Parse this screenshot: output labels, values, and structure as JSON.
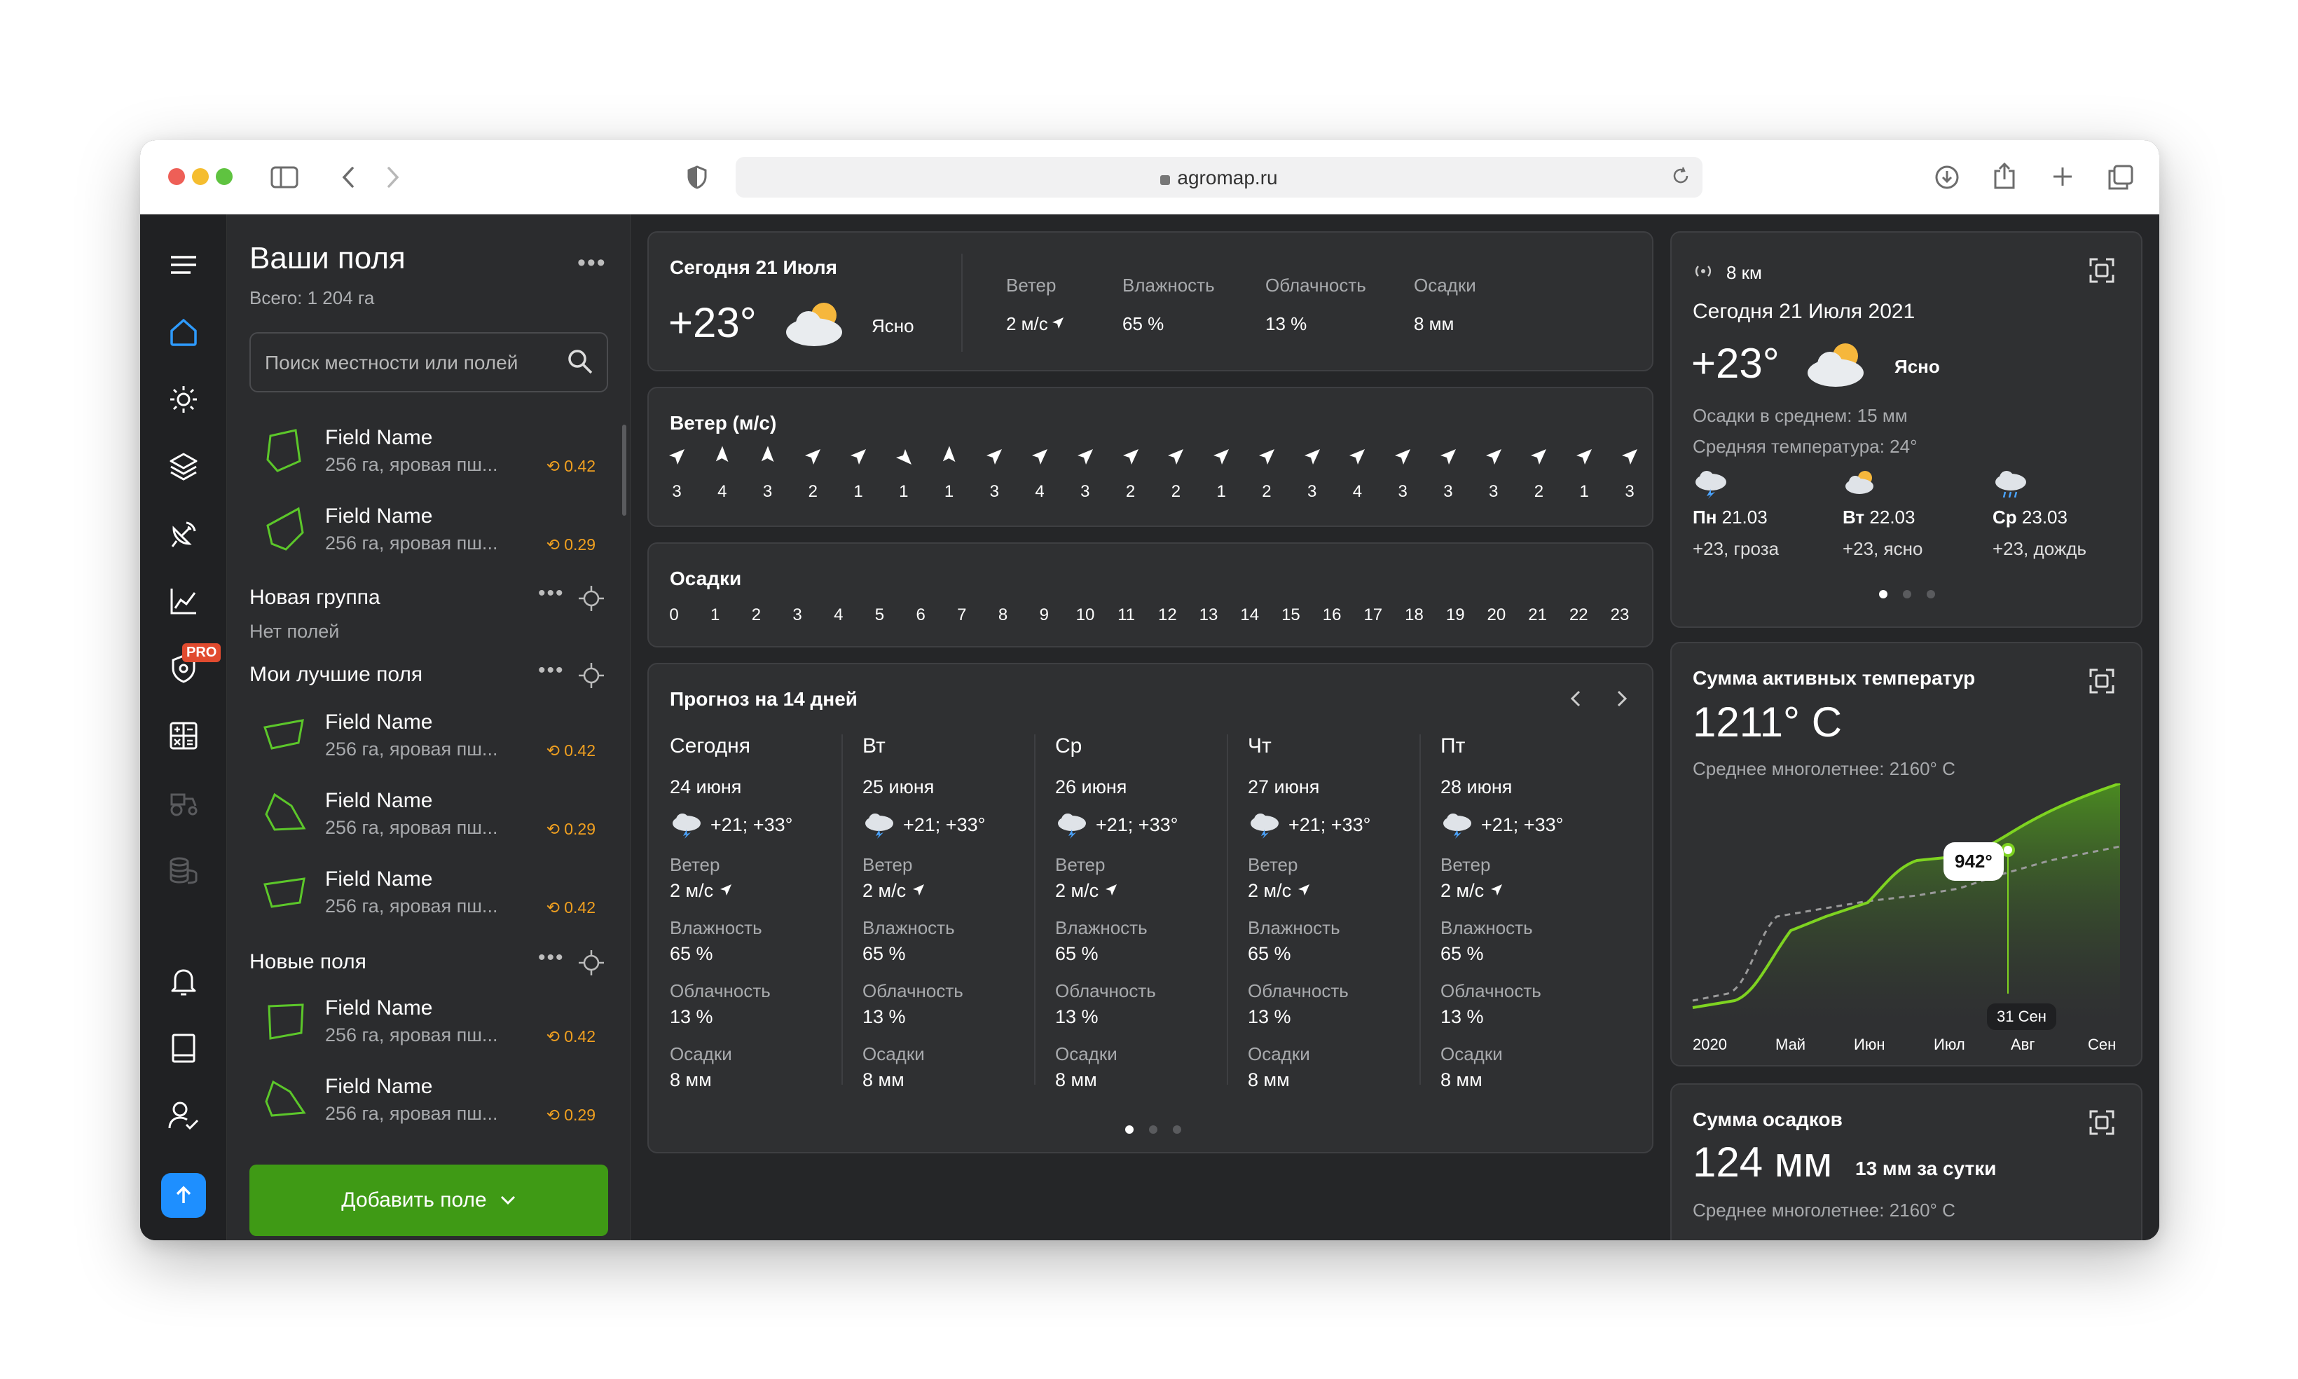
{
  "browser": {
    "url": "agromap.ru"
  },
  "rail": {
    "pro_badge": "PRO",
    "icons": [
      "menu-icon",
      "home-icon",
      "sun-icon",
      "layers-icon",
      "satellite-icon",
      "chart-icon",
      "shield-pro-icon",
      "calculator-icon",
      "tractor-icon",
      "coins-icon",
      "bell-icon",
      "book-icon",
      "user-check-icon",
      "upload-icon"
    ]
  },
  "panel": {
    "title": "Ваши поля",
    "total": "Всего: 1 204 га",
    "search_placeholder": "Поиск местности или полей",
    "add_button": "Добавить поле",
    "ungrouped": [
      {
        "name": "Field Name",
        "desc": "256 га, яровая пш...",
        "ndvi": "0.42"
      },
      {
        "name": "Field Name",
        "desc": "256 га, яровая пш...",
        "ndvi": "0.29"
      }
    ],
    "group1": {
      "name": "Новая группа",
      "empty": "Нет полей"
    },
    "group2": {
      "name": "Мои лучшие поля",
      "fields": [
        {
          "name": "Field Name",
          "desc": "256 га, яровая пш...",
          "ndvi": "0.42"
        },
        {
          "name": "Field Name",
          "desc": "256 га, яровая пш...",
          "ndvi": "0.29"
        },
        {
          "name": "Field Name",
          "desc": "256 га, яровая пш...",
          "ndvi": "0.42"
        }
      ]
    },
    "group3": {
      "name": "Новые поля",
      "fields": [
        {
          "name": "Field Name",
          "desc": "256 га, яровая пш...",
          "ndvi": "0.42"
        },
        {
          "name": "Field Name",
          "desc": "256 га, яровая пш...",
          "ndvi": "0.29"
        }
      ]
    }
  },
  "today": {
    "title": "Сегодня 21 Июля",
    "temp": "+23°",
    "condition": "Ясно",
    "stats": [
      {
        "label": "Ветер",
        "value": "2 м/с"
      },
      {
        "label": "Влажность",
        "value": "65 %"
      },
      {
        "label": "Облачность",
        "value": "13 %"
      },
      {
        "label": "Осадки",
        "value": "8 мм"
      }
    ]
  },
  "wind": {
    "title": "Ветер (м/с)",
    "values": [
      "3",
      "4",
      "3",
      "2",
      "1",
      "1",
      "1",
      "3",
      "4",
      "3",
      "2",
      "2",
      "1",
      "2",
      "3",
      "4",
      "3",
      "3",
      "3",
      "2",
      "1",
      "3"
    ],
    "directions": [
      45,
      0,
      0,
      45,
      45,
      135,
      0,
      45,
      45,
      45,
      45,
      45,
      45,
      45,
      45,
      45,
      45,
      45,
      45,
      45,
      45,
      45
    ]
  },
  "precip": {
    "title": "Осадки",
    "hours": [
      "0",
      "1",
      "2",
      "3",
      "4",
      "5",
      "6",
      "7",
      "8",
      "9",
      "10",
      "11",
      "12",
      "13",
      "14",
      "15",
      "16",
      "17",
      "18",
      "19",
      "20",
      "21",
      "22",
      "23"
    ]
  },
  "forecast": {
    "title": "Прогноз на 14 дней",
    "labels": {
      "wind": "Ветер",
      "humidity": "Влажность",
      "cloud": "Облачность",
      "precip": "Осадки"
    },
    "days": [
      {
        "day": "Сегодня",
        "date": "24 июня",
        "temp": "+21; +33°",
        "wind": "2 м/с",
        "humidity": "65 %",
        "cloud": "13 %",
        "precip": "8 мм"
      },
      {
        "day": "Вт",
        "date": "25 июня",
        "temp": "+21; +33°",
        "wind": "2 м/с",
        "humidity": "65 %",
        "cloud": "13 %",
        "precip": "8 мм"
      },
      {
        "day": "Ср",
        "date": "26 июня",
        "temp": "+21; +33°",
        "wind": "2 м/с",
        "humidity": "65 %",
        "cloud": "13 %",
        "precip": "8 мм"
      },
      {
        "day": "Чт",
        "date": "27 июня",
        "temp": "+21; +33°",
        "wind": "2 м/с",
        "humidity": "65 %",
        "cloud": "13 %",
        "precip": "8 мм"
      },
      {
        "day": "Пт",
        "date": "28 июня",
        "temp": "+21; +33°",
        "wind": "2 м/с",
        "humidity": "65 %",
        "cloud": "13 %",
        "precip": "8 мм"
      }
    ]
  },
  "right_weather": {
    "distance": "8 км",
    "title": "Сегодня 21 Июля 2021",
    "temp": "+23°",
    "condition": "Ясно",
    "avg_precip": "Осадки в среднем: 15 мм",
    "avg_temp": "Средняя температура:  24°",
    "days": [
      {
        "day": "Пн",
        "date": "21.03",
        "desc": "+23, гроза"
      },
      {
        "day": "Вт",
        "date": "22.03",
        "desc": "+23, ясно"
      },
      {
        "day": "Ср",
        "date": "23.03",
        "desc": "+23, дождь"
      }
    ]
  },
  "active_temps": {
    "title": "Сумма активных температур",
    "value": "1211° C",
    "avg": "Среднее многолетнее: 2160° C",
    "tooltip": "942°",
    "marker_date": "31 Сен",
    "x_labels": [
      "2020",
      "Май",
      "Июн",
      "Июл",
      "Авг",
      "Сен"
    ]
  },
  "precip_sum": {
    "title": "Сумма осадков",
    "value": "124 мм",
    "daily": "13 мм за сутки",
    "avg": "Среднее многолетнее: 2160° C"
  },
  "colors": {
    "accent_green": "#3f9a15",
    "line_green": "#7ed321",
    "ndvi_orange": "#f0a020",
    "upload_blue": "#1e8fff"
  }
}
